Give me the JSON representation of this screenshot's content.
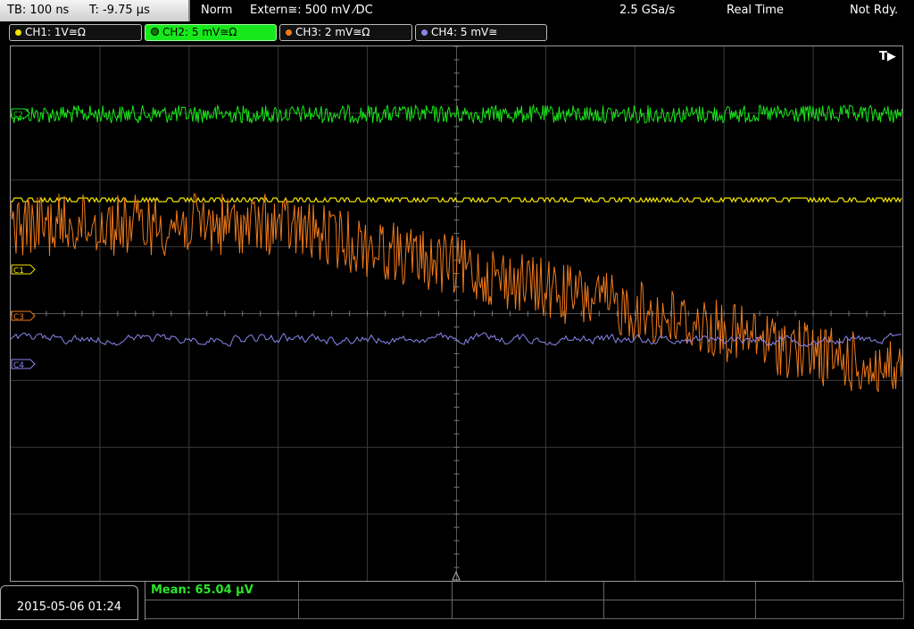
{
  "topbar": {
    "timebase": "TB: 100 ns",
    "trigger_time": "T: -9.75 µs",
    "mode": "Norm",
    "trigger_source": "Extern≅: 500 mV ⁄DC",
    "sample_rate": "2.5 GSa/s",
    "acq_mode": "Real Time",
    "status": "Not Rdy."
  },
  "channels": [
    {
      "label": "CH1: 1V≅Ω",
      "color": "#f2e600",
      "active": false
    },
    {
      "label": "CH2: 5 mV≅Ω",
      "color": "#18e818",
      "active": true
    },
    {
      "label": "CH3: 2 mV≅Ω",
      "color": "#f07a1a",
      "active": false
    },
    {
      "label": "CH4: 5 mV≅",
      "color": "#8a86ee",
      "active": false
    }
  ],
  "screen": {
    "trigger_marker": "T▶",
    "markers": [
      {
        "label": "C1",
        "color": "#f2e600"
      },
      {
        "label": "C3",
        "color": "#f07a1a"
      },
      {
        "label": "C4",
        "color": "#8a86ee"
      },
      {
        "label": "C2",
        "color": "#18e818"
      }
    ]
  },
  "footer": {
    "datetime": "2015-05-06 01:24",
    "measurement": "Mean: 65.04 µV"
  }
}
